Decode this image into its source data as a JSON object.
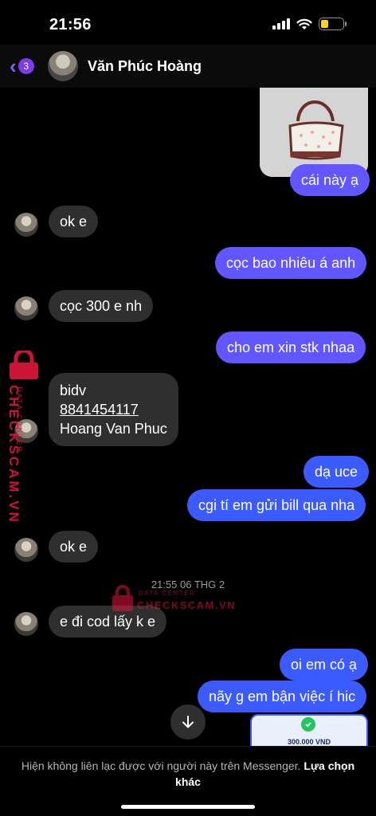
{
  "status_bar": {
    "time": "21:56"
  },
  "header": {
    "unread_count": "3",
    "contact_name": "Văn Phúc Hoàng"
  },
  "messages": [
    {
      "from": "me",
      "text": "cái này ạ"
    },
    {
      "from": "them",
      "text": "ok e"
    },
    {
      "from": "me",
      "text": "cọc bao nhiêu á anh"
    },
    {
      "from": "them",
      "text": "cọc 300 e nh"
    },
    {
      "from": "me",
      "text": "cho em xin stk nhaa"
    },
    {
      "from": "them",
      "bank": "bidv",
      "account_number": "8841454117",
      "account_name": "Hoang Van Phuc"
    },
    {
      "from": "me",
      "text": "dạ uce"
    },
    {
      "from": "me",
      "text": "cgi tí em gửi bill qua nha"
    },
    {
      "from": "them",
      "text": "ok e"
    },
    {
      "from": "them",
      "text": "e đi cod lấy k e"
    },
    {
      "from": "me",
      "text": "oi em có ạ"
    },
    {
      "from": "me",
      "text": "nãy g em bận việc í hic"
    }
  ],
  "timestamp": "21:55 06 THG 2",
  "bill_preview": {
    "amount": "300.000 VND"
  },
  "footer": {
    "notice": "Hiện không liên lạc được với người này trên Messenger.",
    "link": "Lựa chọn khác"
  },
  "watermark": {
    "brand": "CHECKSCAM.VN",
    "subtitle": "DATA CENTER"
  },
  "colors": {
    "outgoing": "#6156ff",
    "outgoing_alt": "#3c5bff",
    "incoming": "#2f2f2f",
    "accent": "#7c3aed",
    "watermark": "#e3173e"
  }
}
